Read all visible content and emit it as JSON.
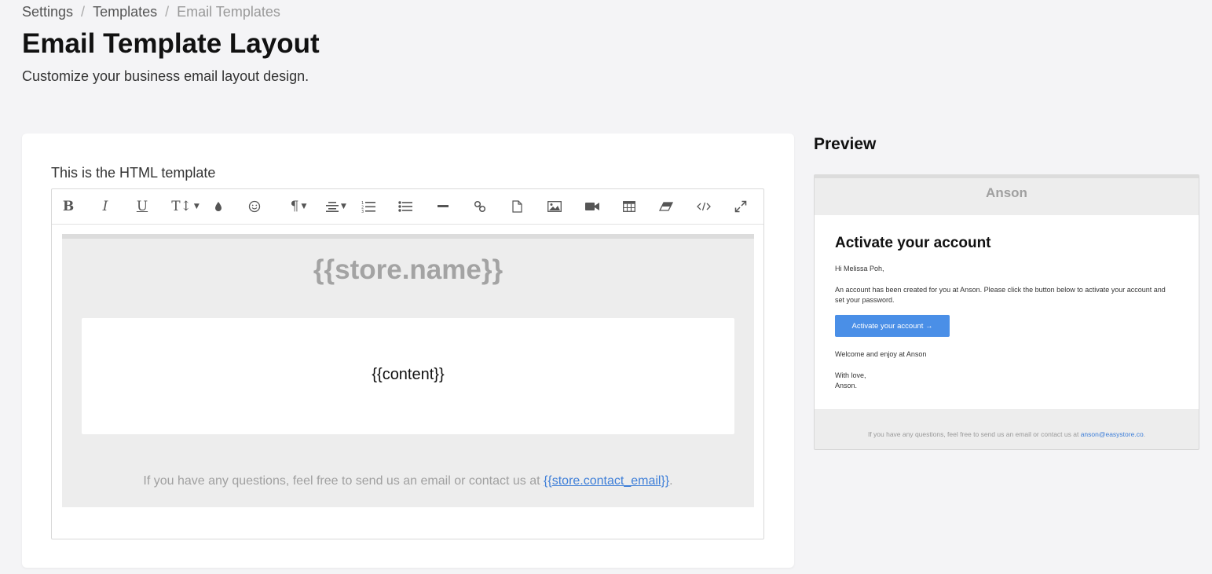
{
  "breadcrumb": {
    "items": [
      "Settings",
      "Templates",
      "Email Templates"
    ],
    "separator": "/"
  },
  "page": {
    "title": "Email Template Layout",
    "subtitle": "Customize your business email layout design."
  },
  "editor": {
    "label": "This is the HTML template",
    "toolbar": [
      {
        "name": "bold-button",
        "icon": "bold-icon"
      },
      {
        "name": "italic-button",
        "icon": "italic-icon"
      },
      {
        "name": "underline-button",
        "icon": "underline-icon"
      },
      {
        "name": "font-size-button",
        "icon": "font-size-icon"
      },
      {
        "name": "text-color-button",
        "icon": "droplet-icon"
      },
      {
        "name": "emoji-button",
        "icon": "emoji-icon"
      },
      {
        "name": "paragraph-format-button",
        "icon": "pilcrow-icon"
      },
      {
        "name": "align-button",
        "icon": "align-icon"
      },
      {
        "name": "ordered-list-button",
        "icon": "ordered-list-icon"
      },
      {
        "name": "unordered-list-button",
        "icon": "unordered-list-icon"
      },
      {
        "name": "horizontal-line-button",
        "icon": "horizontal-line-icon"
      },
      {
        "name": "insert-link-button",
        "icon": "link-icon"
      },
      {
        "name": "insert-file-button",
        "icon": "file-icon"
      },
      {
        "name": "insert-image-button",
        "icon": "image-icon"
      },
      {
        "name": "insert-video-button",
        "icon": "video-icon"
      },
      {
        "name": "insert-table-button",
        "icon": "table-icon"
      },
      {
        "name": "clear-formatting-button",
        "icon": "eraser-icon"
      },
      {
        "name": "code-view-button",
        "icon": "code-icon"
      },
      {
        "name": "fullscreen-button",
        "icon": "expand-icon"
      }
    ],
    "canvas": {
      "store_name": "{{store.name}}",
      "content": "{{content}}",
      "footer_text": "If you have any questions, feel free to send us an email or contact us at ",
      "footer_link": "{{store.contact_email}}",
      "footer_end": "."
    }
  },
  "preview": {
    "title": "Preview",
    "store": "Anson",
    "heading": "Activate your account",
    "greeting": "Hi Melissa Poh,",
    "body": "An account has been created for you at Anson. Please click the button below to activate your account and set your password.",
    "button": "Activate your account →",
    "welcome": "Welcome and enjoy at Anson",
    "signoff_1": "With love,",
    "signoff_2": "Anson.",
    "footer_text": "If you have any questions, feel free to send us an email or contact us at ",
    "footer_link": "anson@easystore.co",
    "footer_end": "."
  },
  "colors": {
    "accent": "#4a8fe7",
    "link": "#3d7ed8",
    "background": "#f4f4f6"
  }
}
